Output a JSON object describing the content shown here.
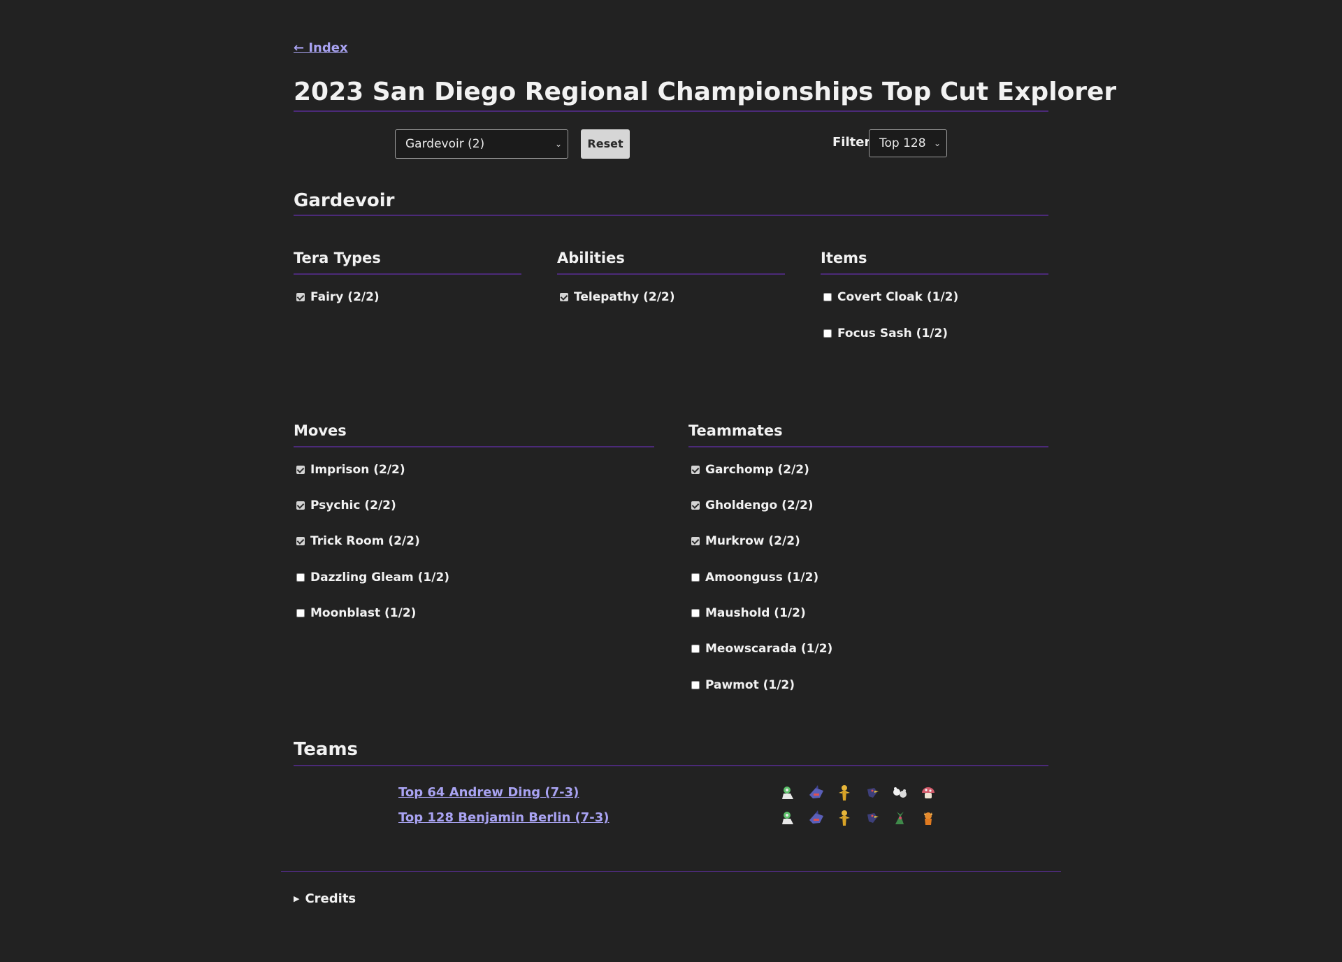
{
  "nav": {
    "back_link": "← Index"
  },
  "page": {
    "title": "2023 San Diego Regional Championships Top Cut Explorer"
  },
  "controls": {
    "pokemon_select": "Gardevoir (2)",
    "reset_label": "Reset",
    "filter_label": "Filter:",
    "filter_value": "Top 128"
  },
  "pokemon": {
    "name": "Gardevoir",
    "tera_types": {
      "heading": "Tera Types",
      "items": [
        {
          "label": "Fairy (2/2)",
          "checked": true
        }
      ]
    },
    "abilities": {
      "heading": "Abilities",
      "items": [
        {
          "label": "Telepathy (2/2)",
          "checked": true
        }
      ]
    },
    "items": {
      "heading": "Items",
      "items": [
        {
          "label": "Covert Cloak (1/2)",
          "checked": false
        },
        {
          "label": "Focus Sash (1/2)",
          "checked": false
        }
      ]
    },
    "moves": {
      "heading": "Moves",
      "items": [
        {
          "label": "Imprison (2/2)",
          "checked": true
        },
        {
          "label": "Psychic (2/2)",
          "checked": true
        },
        {
          "label": "Trick Room (2/2)",
          "checked": true
        },
        {
          "label": "Dazzling Gleam (1/2)",
          "checked": false
        },
        {
          "label": "Moonblast (1/2)",
          "checked": false
        }
      ]
    },
    "teammates": {
      "heading": "Teammates",
      "items": [
        {
          "label": "Garchomp (2/2)",
          "checked": true
        },
        {
          "label": "Gholdengo (2/2)",
          "checked": true
        },
        {
          "label": "Murkrow (2/2)",
          "checked": true
        },
        {
          "label": "Amoonguss (1/2)",
          "checked": false
        },
        {
          "label": "Maushold (1/2)",
          "checked": false
        },
        {
          "label": "Meowscarada (1/2)",
          "checked": false
        },
        {
          "label": "Pawmot (1/2)",
          "checked": false
        }
      ]
    }
  },
  "teams": {
    "heading": "Teams",
    "rows": [
      {
        "label": "Top 64 Andrew Ding (7-3)",
        "sprites": [
          "gardevoir-icon",
          "garchomp-icon",
          "gholdengo-icon",
          "murkrow-icon",
          "maushold-icon",
          "amoonguss-icon"
        ]
      },
      {
        "label": "Top 128 Benjamin Berlin (7-3)",
        "sprites": [
          "gardevoir-icon",
          "garchomp-icon",
          "gholdengo-icon",
          "murkrow-icon",
          "meowscarada-icon",
          "pawmot-icon"
        ]
      }
    ]
  },
  "footer": {
    "credits_label": "Credits"
  },
  "colors": {
    "background": "#222222",
    "accent_rule": "#4b2a78",
    "link": "#a9a3f2"
  }
}
